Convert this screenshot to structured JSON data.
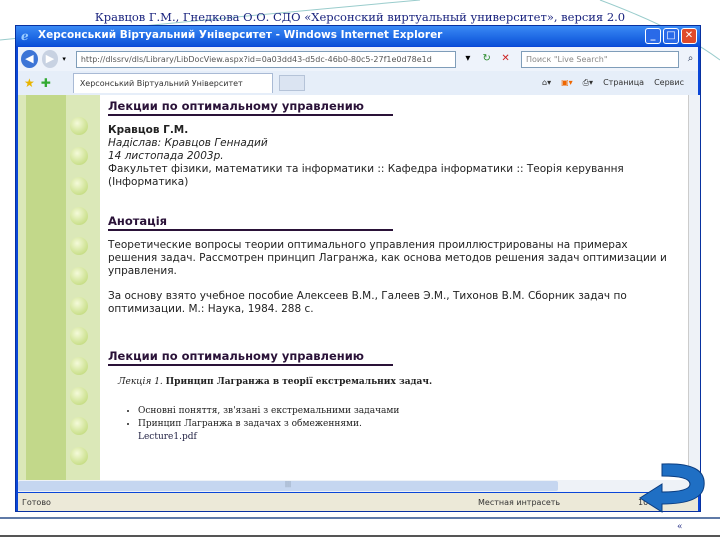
{
  "slide": {
    "title": "Кравцов Г.М., Гнедкова О.О.  СДО «Херсонский виртуальный университет», версия 2.0",
    "page_number": "«"
  },
  "browser": {
    "title": "Херсонський Віртуальний Університет - Windows Internet Explorer",
    "address": "http://dlssrv/dls/Library/LibDocView.aspx?id=0a03dd43-d5dc-46b0-80c5-27f1e0d78e1d",
    "search_placeholder": "Поиск \"Live Search\"",
    "tab_label": "Херсонський Віртуальний Університет",
    "page_menu": "Страница",
    "tools_menu": "Сервис",
    "status_left": "Готово",
    "zone": "Местная интрасеть",
    "zoom": "100%"
  },
  "page": {
    "heading1": "Лекции по оптимальному управлению",
    "author": "Кравцов Г.М.",
    "sent_by": "Надіслав: Кравцов Геннадий",
    "date": "14 листопада 2003р.",
    "path": "Факультет фізики, математики та інформатики :: Кафедра інформатики :: Теорія керування (Інформатика)",
    "heading2": "Анотація",
    "abstract": "Теоретические вопросы теории оптимального управления проиллюстрированы на примерах решения задач. Рассмотрен принцип Лагранжа, как основа методов решения задач оптимизации и управления.",
    "source": "За основу взято учебное пособие Алексеев В.М., Галеев Э.М., Тихонов В.М. Сборник задач по оптимизации.  М.: Наука, 1984.  288 с.",
    "heading3": "Лекции по оптимальному управлению",
    "lecture_prefix": "Лекція 1.",
    "lecture_title": "Принцип Лагранжа в теорії екстремальних задач.",
    "bullets": [
      "Основні поняття, зв'язані з екстремальними задачами",
      "Принцип Лагранжа в задачах з обмеженнями."
    ],
    "file_link": "Lecture1.pdf"
  }
}
